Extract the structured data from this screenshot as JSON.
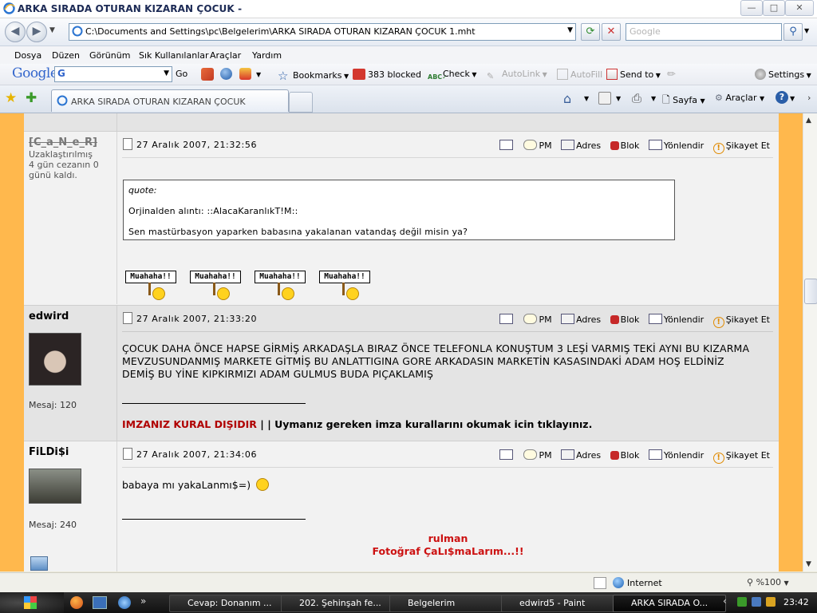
{
  "window": {
    "title": "ARKA SIRADA OTURAN KIZARAN ÇOCUK -",
    "btn_min": "—",
    "btn_max": "□",
    "btn_close": "✕"
  },
  "address": {
    "url": "C:\\Documents and Settings\\pc\\Belgelerim\\ARKA SIRADA OTURAN KIZARAN ÇOCUK 1.mht",
    "search_placeholder": "Google"
  },
  "menu": [
    "Dosya",
    "Düzen",
    "Görünüm",
    "Sık Kullanılanlar",
    "Araçlar",
    "Yardım"
  ],
  "gtoolbar": {
    "logo": "Google",
    "go": "Go",
    "bookmarks": "Bookmarks",
    "blocked": "383 blocked",
    "check": "Check",
    "autolink": "AutoLink",
    "autofill": "AutoFill",
    "sendto": "Send to",
    "settings": "Settings"
  },
  "tab": {
    "title": "ARKA SIRADA OTURAN KIZARAN ÇOCUK"
  },
  "cmdbar": {
    "page": "Sayfa",
    "tools": "Araçlar"
  },
  "post_actions": {
    "pm": "PM",
    "adres": "Adres",
    "blok": "Blok",
    "yonlendir": "Yönlendir",
    "sikayet": "Şikayet Et"
  },
  "posts": [
    {
      "username": "[C_a_N_e_R]",
      "status_lines": [
        "Uzaklaştırılmış",
        "4 gün cezanın 0",
        "günü kaldı."
      ],
      "date": "27 Aralık 2007, 21:32:56",
      "quote_label": "quote:",
      "quote_from": "Orjinalden alıntı: ::AlacaKaranlıkT!M::",
      "quote_text": "Sen mastürbasyon yaparken babasına yakalanan vatandaş değil misin ya?",
      "smiley_text": "Muahaha!!"
    },
    {
      "username": "edwird",
      "message_count": "Mesaj: 120",
      "date": "27 Aralık 2007, 21:33:20",
      "body_lines": [
        "ÇOCUK DAHA ÖNCE HAPSE GİRMİŞ ARKADAŞLA BIRAZ ÖNCE TELEFONLA KONUŞTUM 3 LEŞİ VARMIŞ TEKİ AYNI BU KIZARMA",
        "MEVZUSUNDANMIŞ MARKETE GİTMİŞ BU ANLATTIGINA GORE ARKADASIN MARKETİN KASASINDAKİ ADAM HOŞ ELDİNİZ",
        "DEMİŞ BU YİNE KIPKIRMIZI ADAM GULMUS BUDA PIÇAKLAMIŞ"
      ],
      "sig_red": "IMZANIZ KURAL DIŞIDIR",
      "sig_rest": " | | Uymanız gereken imza kurallarını okumak icin tıklayınız."
    },
    {
      "username": "FiLDi$i",
      "message_count": "Mesaj: 240",
      "date": "27 Aralık 2007, 21:34:06",
      "body": "babaya mı yakaLanmı$=)",
      "sig_line1": "rulman",
      "sig_line2": "Fotoğraf ÇaLı$maLarım...!!"
    }
  ],
  "status": {
    "zone": "Internet",
    "zoom": "%100"
  },
  "taskbar": {
    "tasks": [
      "Cevap: Donanım ...",
      "202. Şehinşah fe...",
      "Belgelerim",
      "edwird5 - Paint",
      "ARKA SIRADA O..."
    ],
    "clock": "23:42"
  },
  "colors": {
    "page_bg": "#ffb84d",
    "forum_bg": "#f2f2f2",
    "post_alt_bg": "#e4e4e4",
    "warning_red": "#b00000",
    "sig_red": "#cc1111"
  }
}
